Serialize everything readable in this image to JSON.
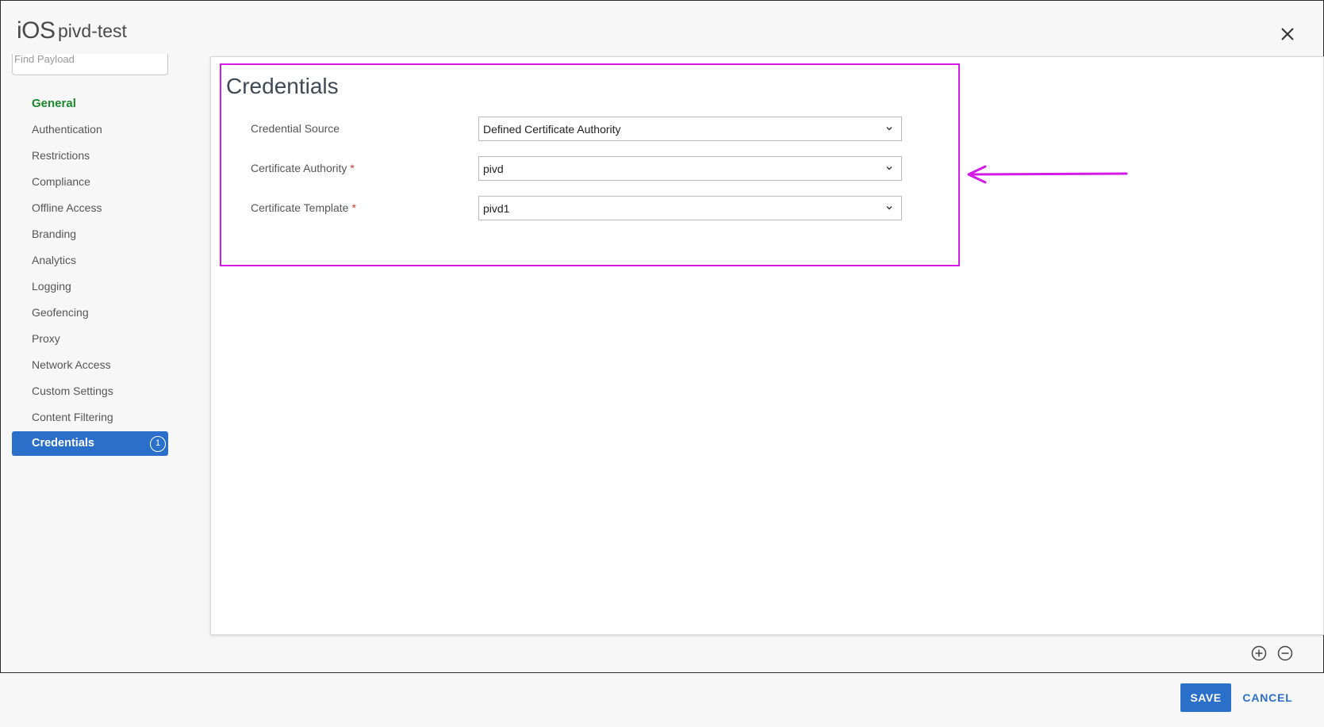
{
  "header": {
    "platform": "iOS",
    "profile_name": "pivd-test"
  },
  "search": {
    "placeholder": "Find Payload"
  },
  "sidebar": {
    "items": [
      {
        "label": "General"
      },
      {
        "label": "Authentication"
      },
      {
        "label": "Restrictions"
      },
      {
        "label": "Compliance"
      },
      {
        "label": "Offline Access"
      },
      {
        "label": "Branding"
      },
      {
        "label": "Analytics"
      },
      {
        "label": "Logging"
      },
      {
        "label": "Geofencing"
      },
      {
        "label": "Proxy"
      },
      {
        "label": "Network Access"
      },
      {
        "label": "Custom Settings"
      },
      {
        "label": "Content Filtering"
      },
      {
        "label": "Credentials",
        "badge": "1"
      }
    ]
  },
  "section": {
    "title": "Credentials",
    "fields": [
      {
        "label": "Credential Source",
        "required": "",
        "value": "Defined Certificate Authority"
      },
      {
        "label": "Certificate Authority",
        "required": "*",
        "value": "pivd"
      },
      {
        "label": "Certificate Template",
        "required": "*",
        "value": "pivd1"
      }
    ]
  },
  "footer": {
    "save_label": "SAVE",
    "cancel_label": "CANCEL"
  },
  "colors": {
    "accent": "#2a6fc9",
    "general_green": "#1a8a2a",
    "highlight_magenta": "#d41be6",
    "required_red": "#d23a2a"
  },
  "icons": {
    "close": "close-icon",
    "chevron": "chevron-down-icon",
    "zoom_in": "plus-circle-icon",
    "zoom_out": "minus-circle-icon",
    "annotation_arrow": "arrow-left-icon"
  }
}
